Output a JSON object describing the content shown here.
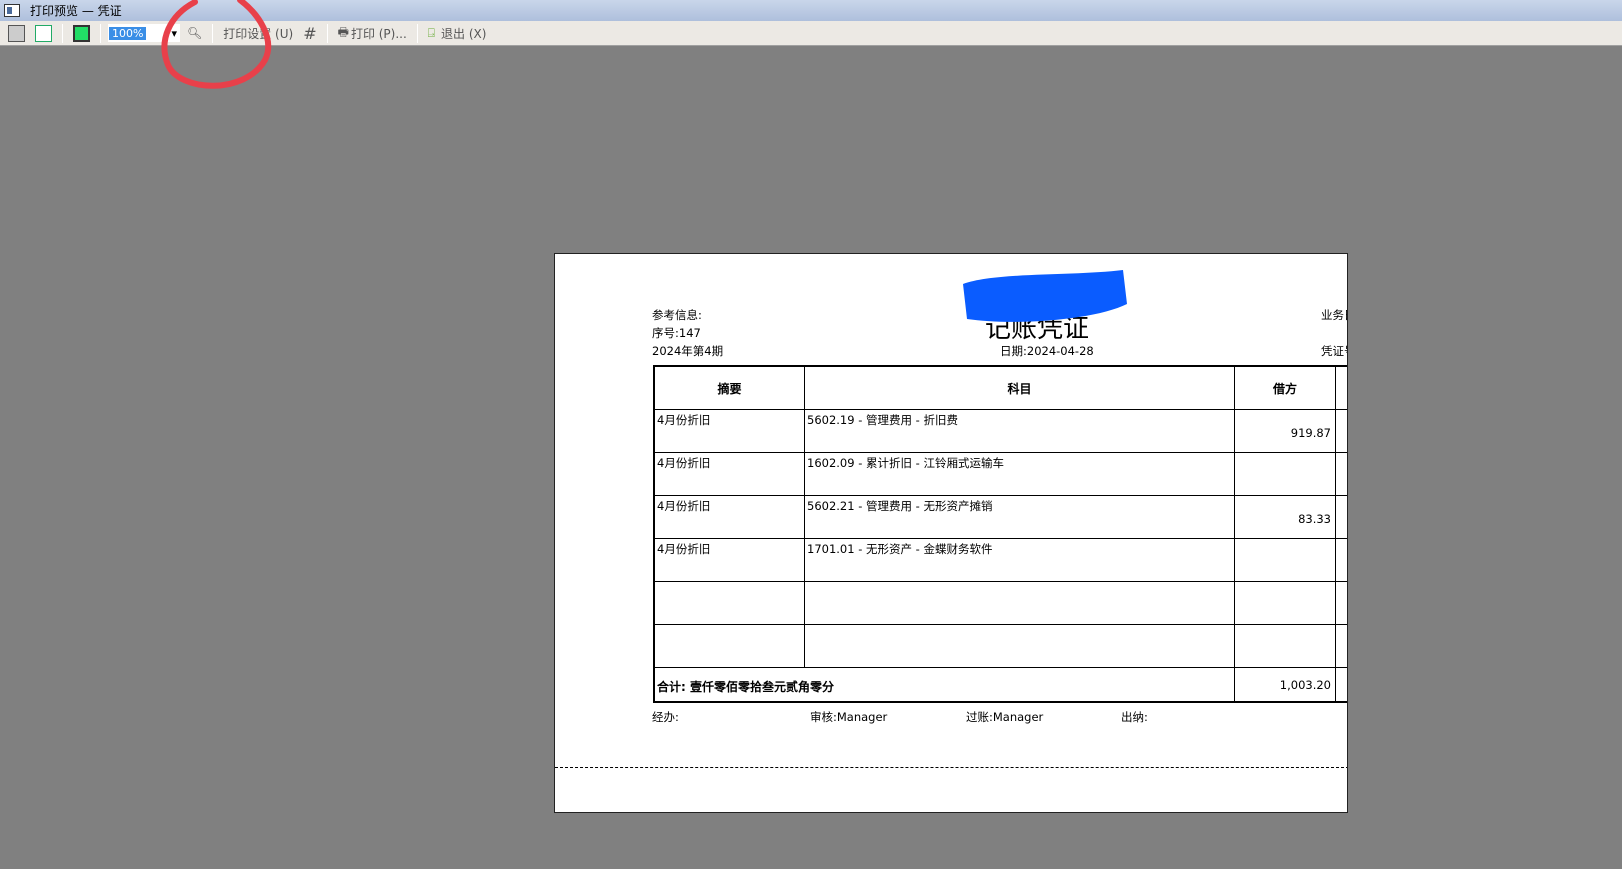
{
  "window": {
    "title": "打印预览 — 凭证"
  },
  "toolbar": {
    "zoom": "100%",
    "print_setup": "打印设置 (U)",
    "print": "打印 (P)...",
    "exit": "退出 (X)"
  },
  "voucher": {
    "ref_label": "参考信息:",
    "seq": "序号:147",
    "period": "2024年第4期",
    "title": "记账凭证",
    "date": "日期:2024-04-28",
    "biz_date_label": "业务日",
    "voucher_no_label": "凭证号",
    "headers": {
      "summary": "摘要",
      "account": "科目",
      "debit": "借方"
    },
    "rows": [
      {
        "summary": "4月份折旧",
        "account": "5602.19 - 管理费用 - 折旧费",
        "debit": "919.87"
      },
      {
        "summary": "4月份折旧",
        "account": "1602.09 - 累计折旧 - 江铃厢式运输车",
        "debit": ""
      },
      {
        "summary": "4月份折旧",
        "account": "5602.21 - 管理费用 - 无形资产摊销",
        "debit": "83.33"
      },
      {
        "summary": "4月份折旧",
        "account": "1701.01 - 无形资产 - 金蝶财务软件",
        "debit": ""
      },
      {
        "summary": "",
        "account": "",
        "debit": ""
      },
      {
        "summary": "",
        "account": "",
        "debit": ""
      }
    ],
    "total_label": "合计: 壹仟零佰零拾叁元贰角零分",
    "total_debit": "1,003.20",
    "handler": "经办:",
    "reviewer": "审核:Manager",
    "poster": "过账:Manager",
    "cashier": "出纳:"
  },
  "colors": {
    "background": "#808080",
    "annotation": "#e8404a",
    "redaction": "#0a5cff"
  }
}
